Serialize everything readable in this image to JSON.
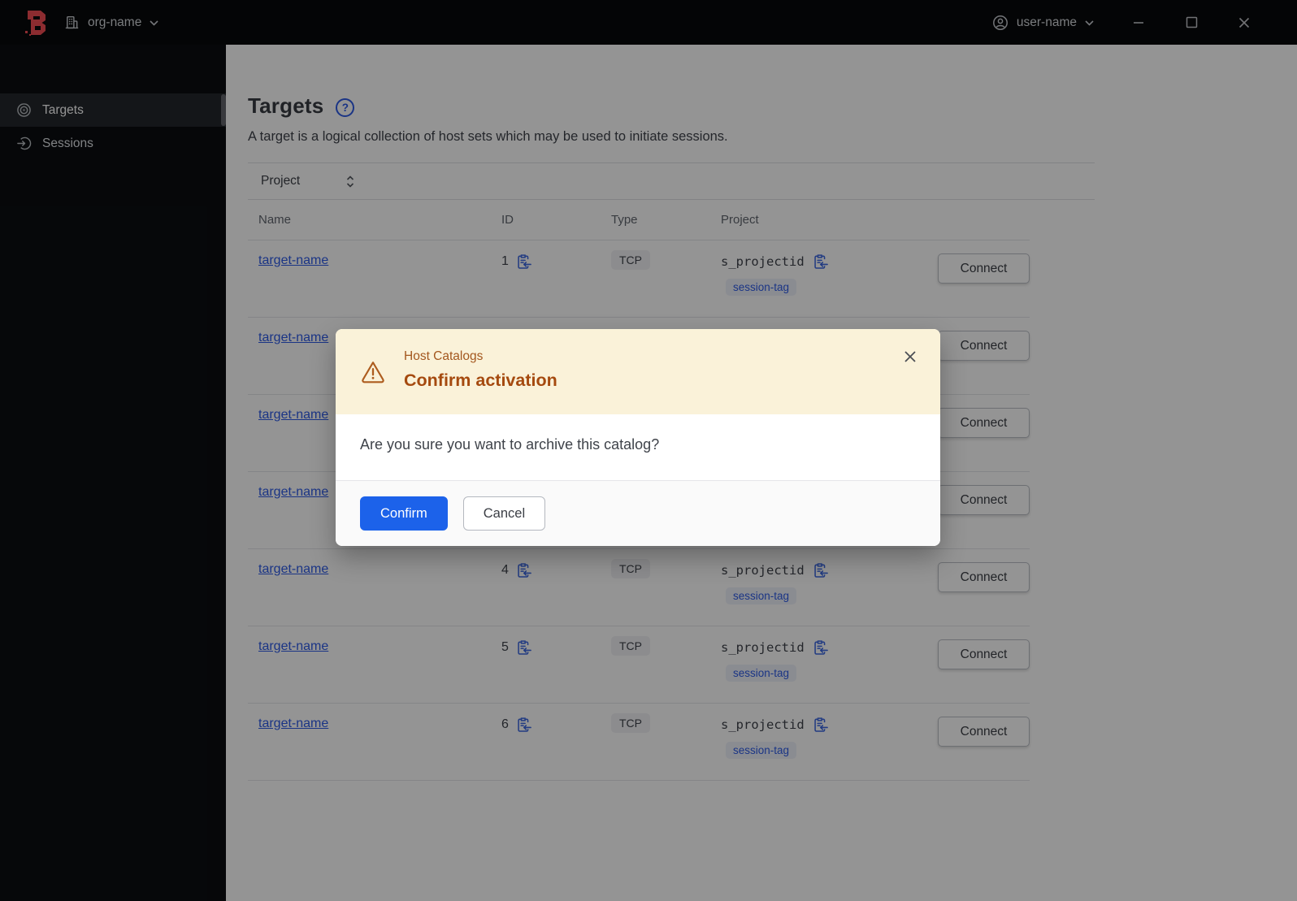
{
  "topbar": {
    "org_label": "org-name",
    "user_label": "user-name"
  },
  "sidebar": {
    "items": [
      {
        "label": "Targets",
        "active": true
      },
      {
        "label": "Sessions",
        "active": false
      }
    ]
  },
  "page": {
    "title": "Targets",
    "description": "A target is a logical collection of host sets which may be used to initiate sessions."
  },
  "filter": {
    "label": "Project"
  },
  "table": {
    "headers": [
      "Name",
      "ID",
      "Type",
      "Project"
    ],
    "connect_label": "Connect",
    "rows": [
      {
        "name": "target-name",
        "id": "1",
        "type": "TCP",
        "project": "s_projectid",
        "session_tag": "session-tag"
      },
      {
        "name": "target-name",
        "id": null,
        "type": null,
        "project": null,
        "session_tag": null
      },
      {
        "name": "target-name",
        "id": null,
        "type": null,
        "project": null,
        "session_tag": null
      },
      {
        "name": "target-name",
        "id": null,
        "type": null,
        "project": null,
        "session_tag": null
      },
      {
        "name": "target-name",
        "id": "4",
        "type": "TCP",
        "project": "s_projectid",
        "session_tag": "session-tag"
      },
      {
        "name": "target-name",
        "id": "5",
        "type": "TCP",
        "project": "s_projectid",
        "session_tag": "session-tag"
      },
      {
        "name": "target-name",
        "id": "6",
        "type": "TCP",
        "project": "s_projectid",
        "session_tag": "session-tag"
      }
    ]
  },
  "modal": {
    "context": "Host Catalogs",
    "title": "Confirm activation",
    "body": "Are you sure you want to archive this catalog?",
    "confirm_label": "Confirm",
    "cancel_label": "Cancel"
  },
  "icons": {
    "help": "?"
  },
  "colors": {
    "brand_red": "#f24c53",
    "accent_blue": "#2e5be6",
    "confirm_blue": "#1c62ea",
    "warning_bg": "#faf2d9",
    "warning_label": "#a3571e",
    "warning_title": "#a54a0f"
  }
}
